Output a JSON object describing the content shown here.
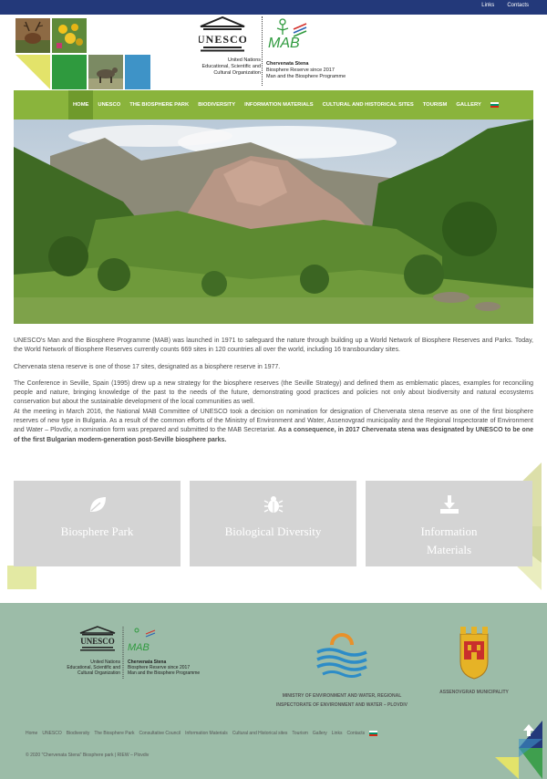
{
  "topbar": {
    "links": [
      {
        "label": "Links"
      },
      {
        "label": "Contacts"
      }
    ]
  },
  "header": {
    "unesco": {
      "wordmark": "UNESCO",
      "lines": [
        "United Nations",
        "Educational, Scientific and",
        "Cultural Organization"
      ]
    },
    "mab": {
      "wordmark": "MAB",
      "lines": [
        "Chervenata Stena",
        "Biosphere Reserve since 2017",
        "Man and the Biosphere Programme"
      ]
    }
  },
  "nav": {
    "items": [
      {
        "label": "Home",
        "active": true
      },
      {
        "label": "UNESCO"
      },
      {
        "label": "The Biosphere Park"
      },
      {
        "label": "Biodiversity"
      },
      {
        "label": "Information Materials"
      },
      {
        "label": "Cultural and Historical Sites"
      },
      {
        "label": "Tourism"
      },
      {
        "label": "Gallery"
      }
    ],
    "language_icon": "bulgarian-flag-icon"
  },
  "content": {
    "p1": "UNESCO's Man and the Biosphere Programme (MAB) was launched in 1971 to safeguard the nature through building up a World Network of Biosphere Reserves and Parks. Today, the World Network of Biosphere Reserves currently counts 669 sites in 120 countries all over the world, including 16 transboundary sites.",
    "p2": "Chervenata stena reserve is one of those 17 sites, designated as a biosphere reserve in 1977.",
    "p3": "The Conference in Seville, Spain (1995) drew up a new strategy for the biosphere reserves (the Seville Strategy) and defined them as emblematic places, examples for reconciling people and nature, bringing knowledge of the past to the needs of the future, demonstrating good practices and policies not only about biodiversity and natural ecosystems conservation but about the sustainable development of the local communities as well.",
    "p4_text": "At the meeting in March 2016, the National MAB Committee of UNESCO took a decision on nomination for designation of Chervenata stena reserve as one of the first biosphere reserves of new type in Bulgaria. As a result of the common efforts of the Ministry of Environment and Water, Assenovgrad municipality and the Regional Inspectorate of Environment and Water – Plovdiv, a nomination form was prepared and submitted to the MAB Secretariat. ",
    "p4_bold": "As a consequence, in 2017 Chervenata stena was designated by UNESCO to be one of the first Bulgarian modern-generation post-Seville biosphere parks."
  },
  "cards": [
    {
      "title": "Biosphere Park",
      "icon": "leaf-icon"
    },
    {
      "title": "Biological Diversity",
      "icon": "bug-icon"
    },
    {
      "title": "Information Materials",
      "icon": "download-icon"
    }
  ],
  "footer": {
    "ministry_caption": "Ministry of Environment and Water, Regional Inspectorate of Environment and Water – Plovdiv",
    "municipality_caption": "Assenovgrad Municipality",
    "links": [
      {
        "label": "Home"
      },
      {
        "label": "UNESCO"
      },
      {
        "label": "Biodiversity"
      },
      {
        "label": "The Biosphere Park"
      },
      {
        "label": "Consultative Council"
      },
      {
        "label": "Information Materials"
      },
      {
        "label": "Cultural and Historical sites"
      },
      {
        "label": "Tourism"
      },
      {
        "label": "Gallery"
      },
      {
        "label": "Links"
      },
      {
        "label": "Contacts"
      }
    ],
    "copyright": "© 2020 \"Chervenata Stena\" Biosphere park | RIEW – Plovdiv"
  },
  "colors": {
    "topbar": "#23397a",
    "nav": "#8ab43c",
    "nav_active": "#6f9a2c",
    "footer": "#9cbca8",
    "card": "#d4d4d4"
  }
}
